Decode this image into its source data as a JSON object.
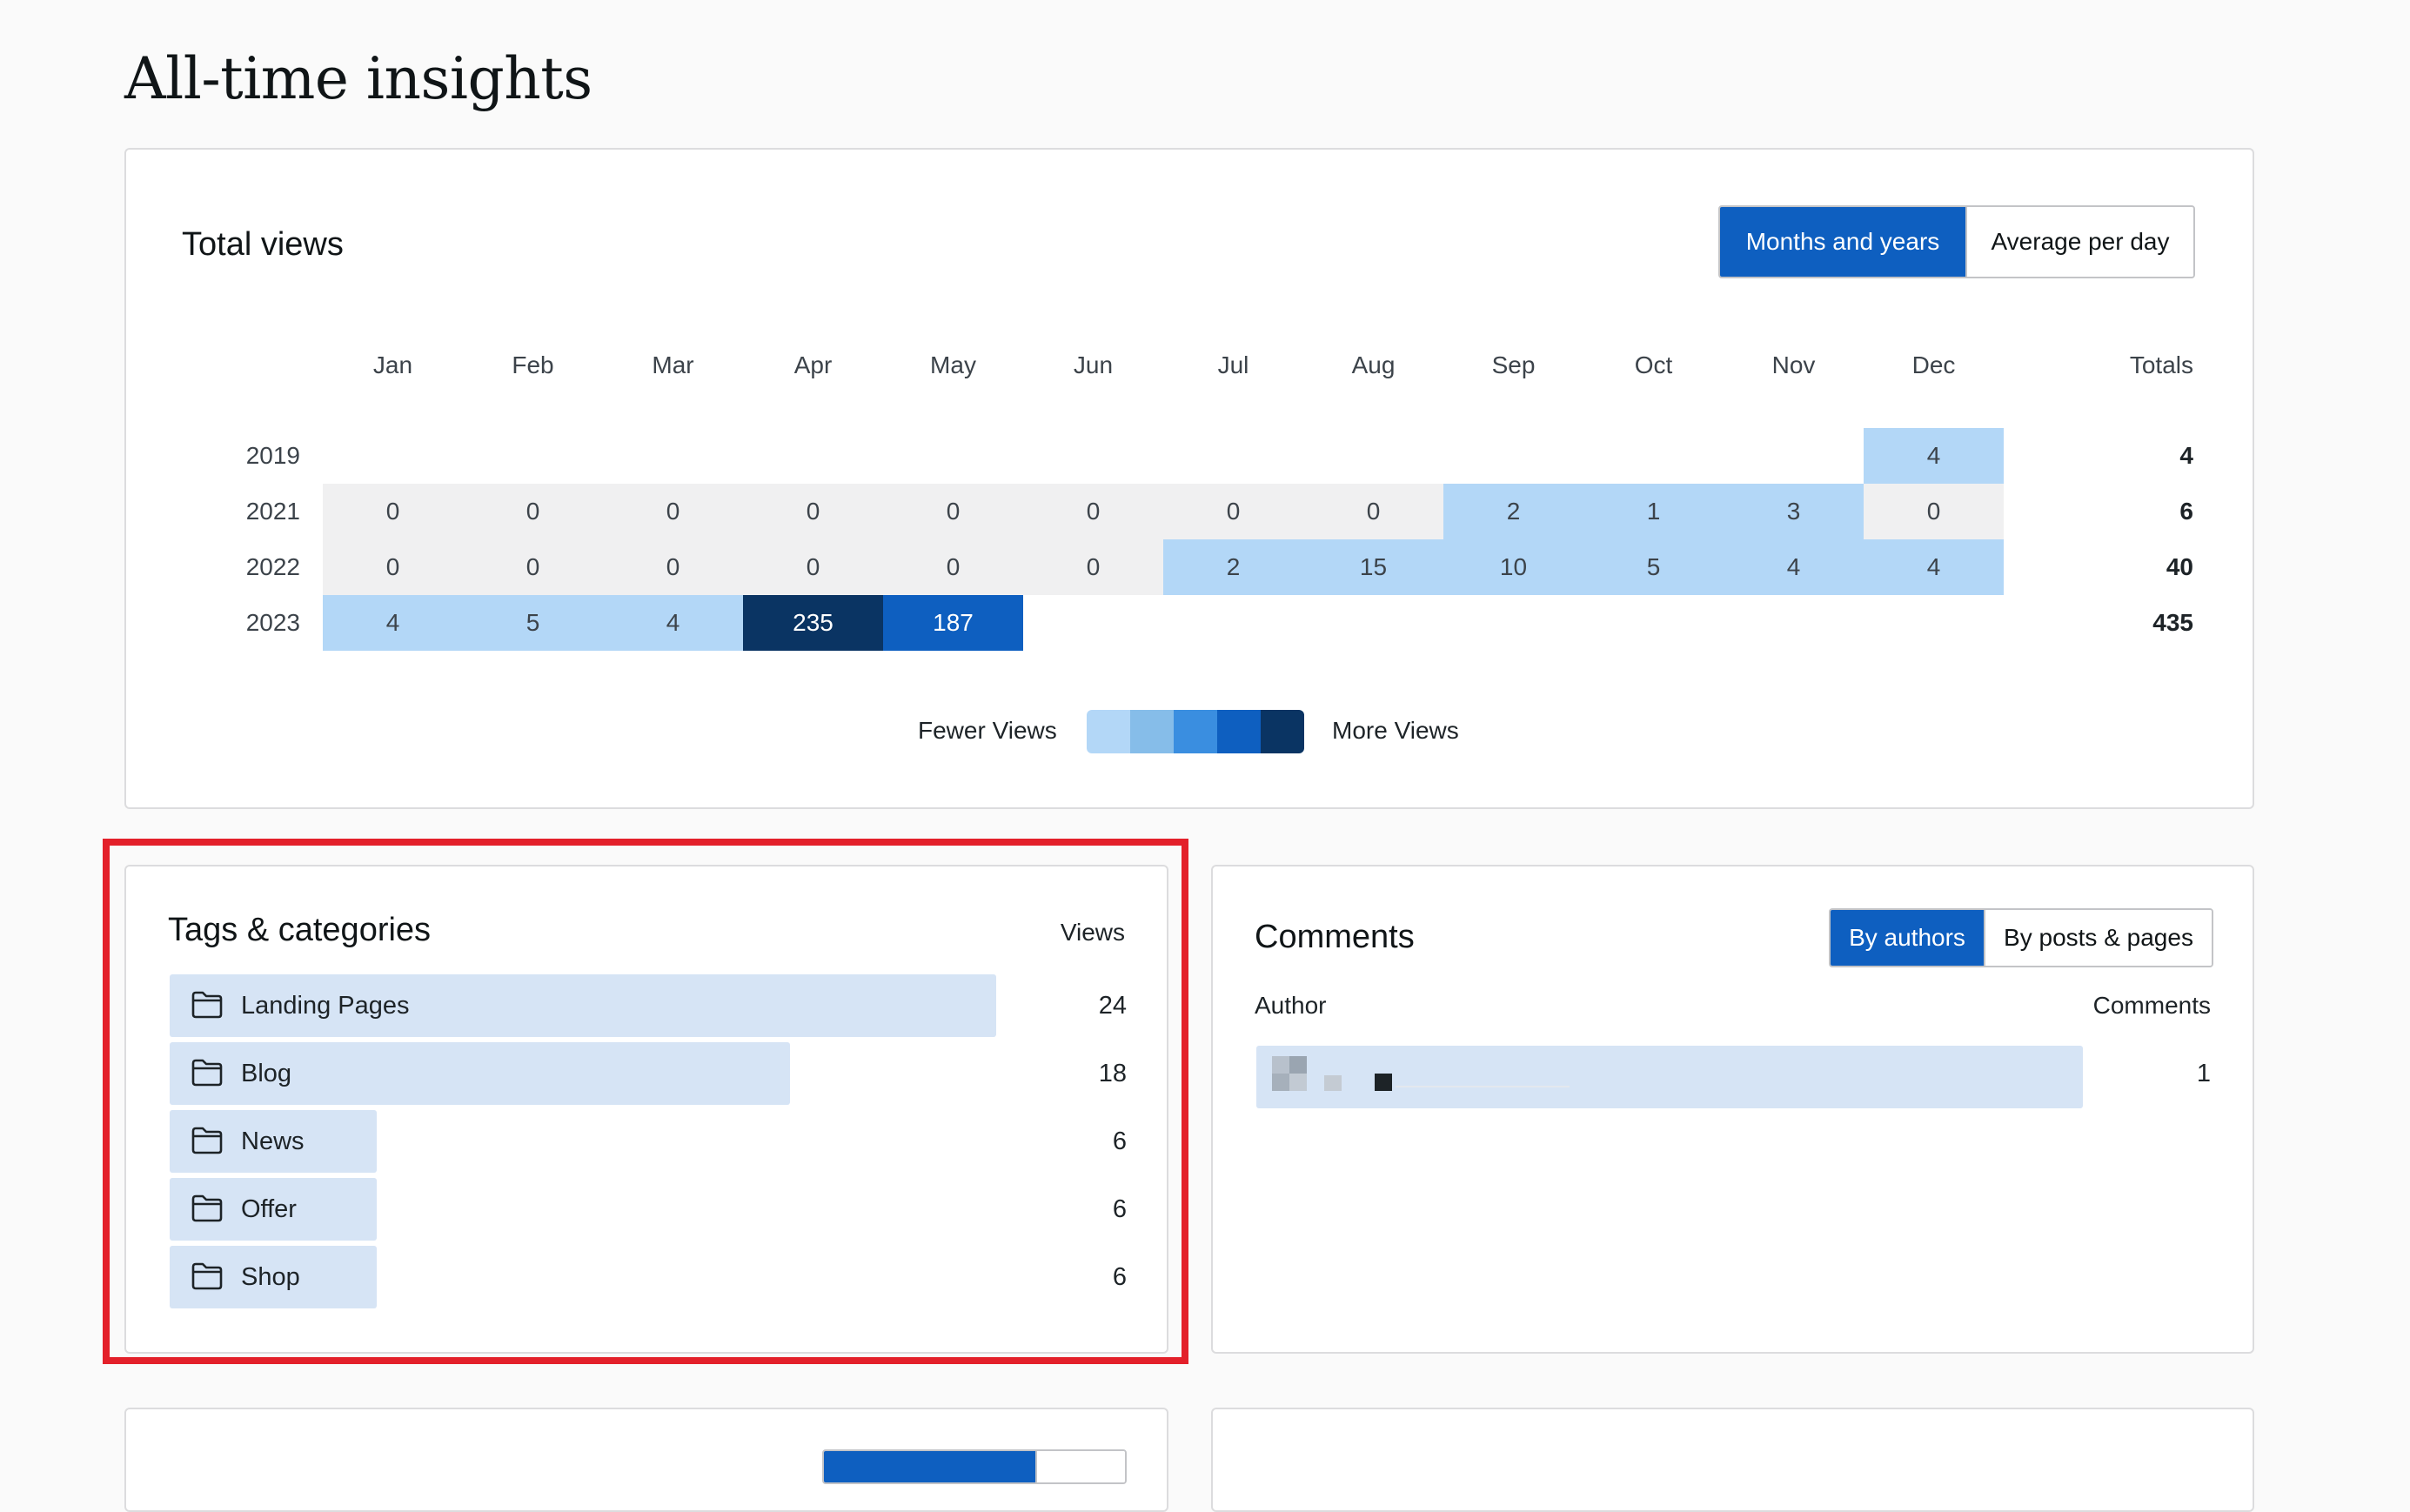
{
  "page": {
    "title": "All-time insights"
  },
  "total_views": {
    "title": "Total views",
    "toggle": {
      "months_years": "Months and years",
      "avg_per_day": "Average per day"
    },
    "months": [
      "Jan",
      "Feb",
      "Mar",
      "Apr",
      "May",
      "Jun",
      "Jul",
      "Aug",
      "Sep",
      "Oct",
      "Nov",
      "Dec"
    ],
    "totals_header": "Totals",
    "rows": [
      {
        "year": "2019",
        "values": [
          null,
          null,
          null,
          null,
          null,
          null,
          null,
          null,
          null,
          null,
          null,
          "4"
        ],
        "total": "4"
      },
      {
        "year": "2021",
        "values": [
          "0",
          "0",
          "0",
          "0",
          "0",
          "0",
          "0",
          "0",
          "2",
          "1",
          "3",
          "0"
        ],
        "total": "6"
      },
      {
        "year": "2022",
        "values": [
          "0",
          "0",
          "0",
          "0",
          "0",
          "0",
          "2",
          "15",
          "10",
          "5",
          "4",
          "4"
        ],
        "total": "40"
      },
      {
        "year": "2023",
        "values": [
          "4",
          "5",
          "4",
          "235",
          "187",
          null,
          null,
          null,
          null,
          null,
          null,
          null
        ],
        "total": "435"
      }
    ],
    "legend": {
      "fewer": "Fewer Views",
      "more": "More Views"
    },
    "colors": {
      "zero": "#f0f0f1",
      "level1": "#b3d7f7",
      "level2": "#86bde9",
      "level3": "#3a8ee0",
      "level4": "#0e5fc0",
      "level5": "#0a3463"
    }
  },
  "tags": {
    "title": "Tags & categories",
    "views_header": "Views",
    "items": [
      {
        "label": "Landing Pages",
        "views": "24"
      },
      {
        "label": "Blog",
        "views": "18"
      },
      {
        "label": "News",
        "views": "6"
      },
      {
        "label": "Offer",
        "views": "6"
      },
      {
        "label": "Shop",
        "views": "6"
      }
    ]
  },
  "comments": {
    "title": "Comments",
    "toggle": {
      "by_authors": "By authors",
      "by_posts": "By posts & pages"
    },
    "author_header": "Author",
    "comments_header": "Comments",
    "rows": [
      {
        "comments": "1"
      }
    ]
  },
  "accent": "#0e5fc0",
  "highlight_color": "#e3202a"
}
